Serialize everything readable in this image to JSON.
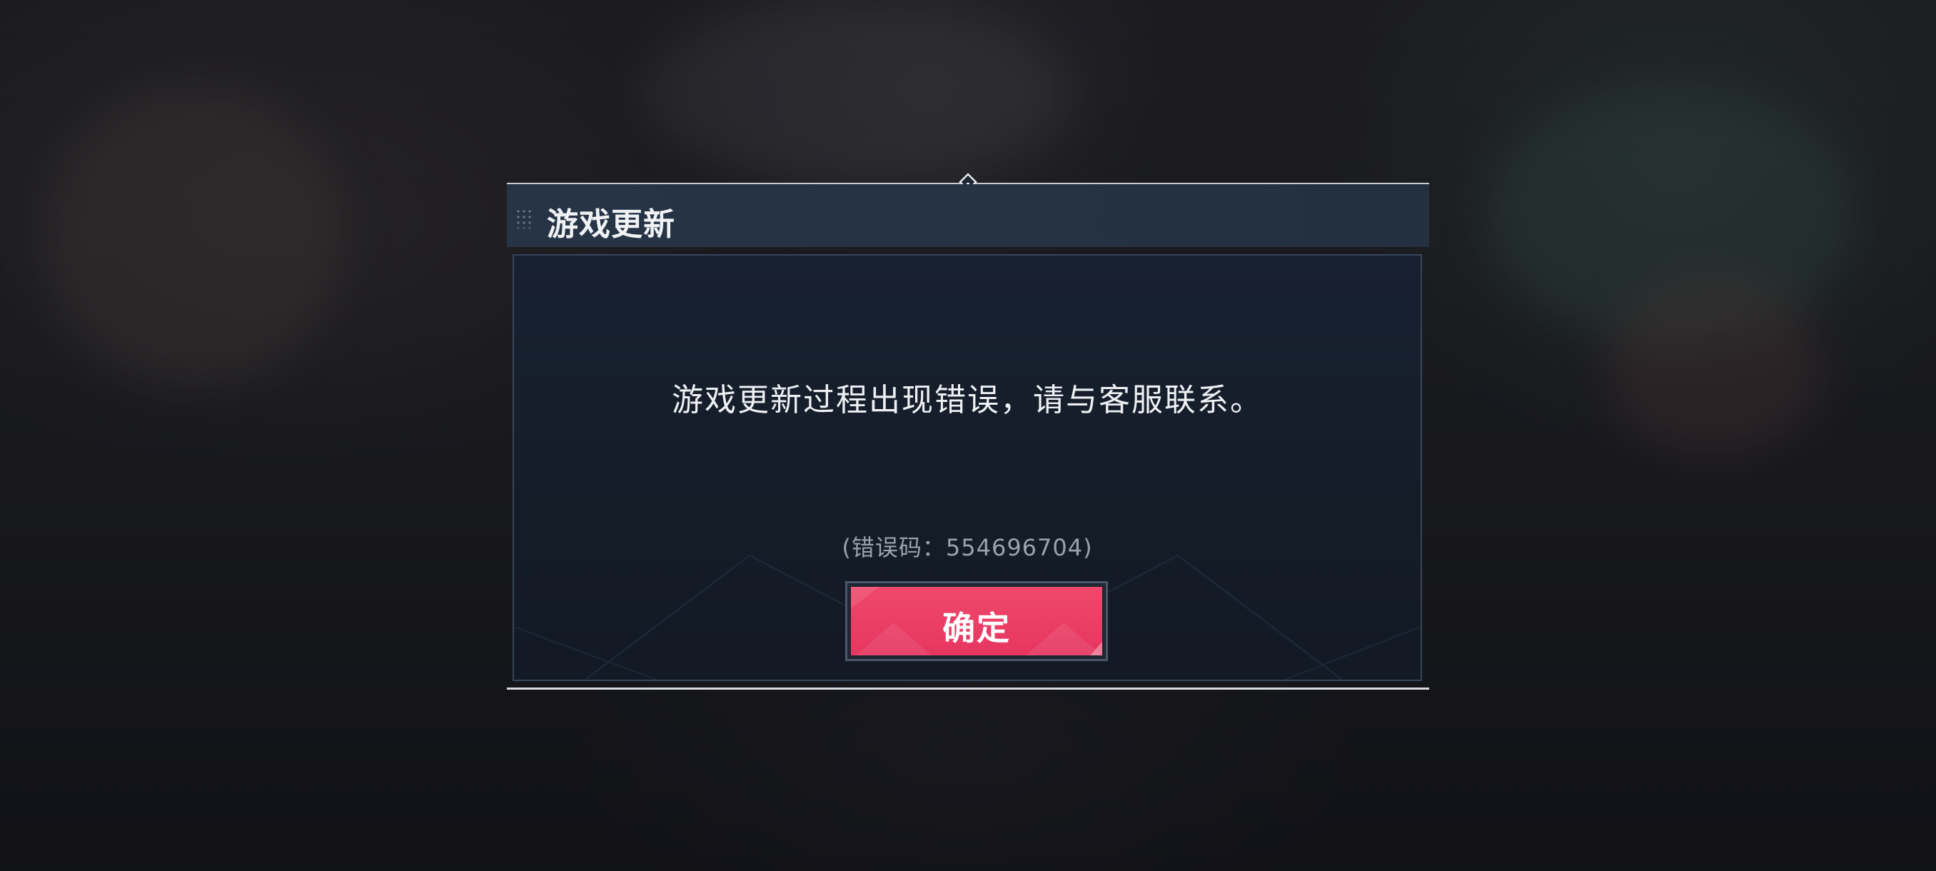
{
  "dialog": {
    "title": "游戏更新",
    "message": "游戏更新过程出现错误，请与客服联系。",
    "error_code": "(错误码：554696704)",
    "confirm_label": "确定"
  },
  "colors": {
    "accent": "#e63660",
    "titlebar": "#263446",
    "panel": "#151d29"
  },
  "icons": [
    "drag-grip-icon",
    "top-ornament-icon"
  ]
}
